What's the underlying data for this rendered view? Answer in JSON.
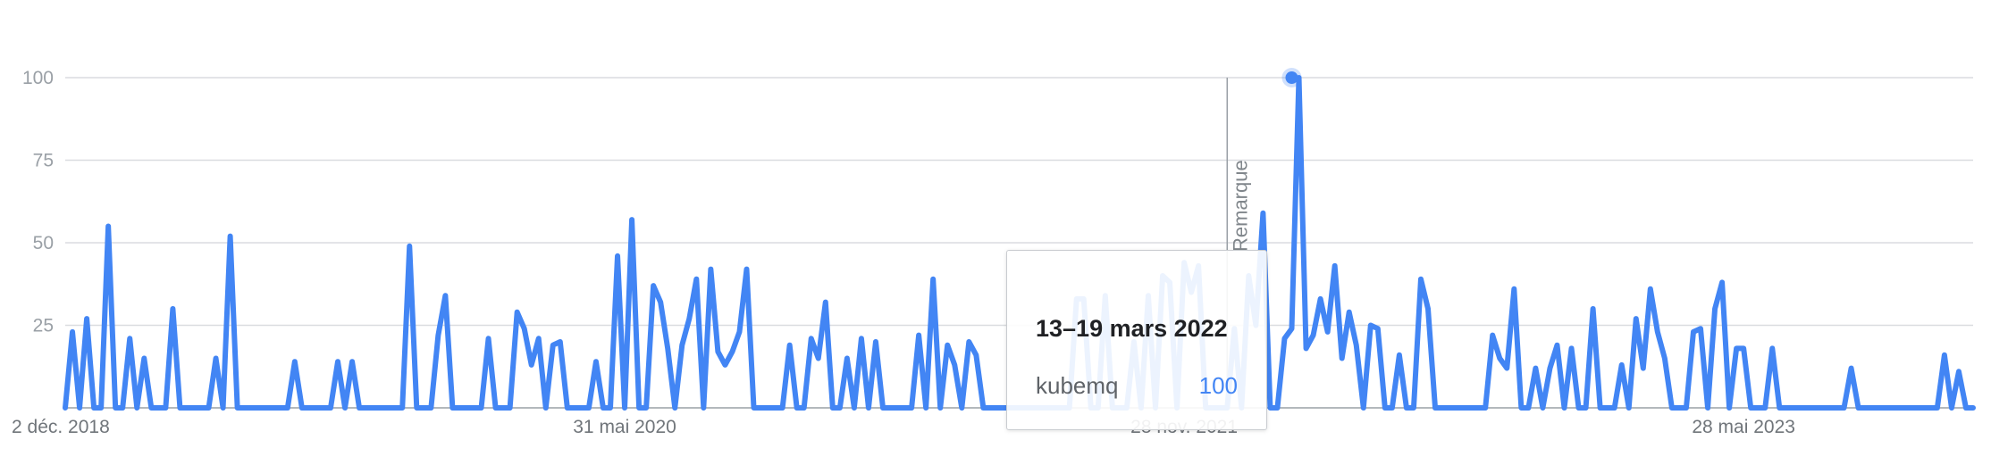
{
  "chart_data": {
    "type": "line",
    "title": "",
    "xlabel": "",
    "ylabel": "",
    "ylim": [
      0,
      100
    ],
    "yticks": [
      25,
      50,
      75,
      100
    ],
    "xtick_labels": [
      "2 déc. 2018",
      "31 mai 2020",
      "28 nov. 2021",
      "28 mai 2023"
    ],
    "grid": true,
    "legend": "none",
    "series": [
      {
        "name": "kubemq",
        "color": "#4285f4",
        "values": [
          0,
          23,
          0,
          27,
          0,
          0,
          55,
          0,
          0,
          21,
          0,
          15,
          0,
          0,
          0,
          30,
          0,
          0,
          0,
          0,
          0,
          15,
          0,
          52,
          0,
          0,
          0,
          0,
          0,
          0,
          0,
          0,
          14,
          0,
          0,
          0,
          0,
          0,
          14,
          0,
          14,
          0,
          0,
          0,
          0,
          0,
          0,
          0,
          49,
          0,
          0,
          0,
          22,
          34,
          0,
          0,
          0,
          0,
          0,
          21,
          0,
          0,
          0,
          29,
          24,
          13,
          21,
          0,
          19,
          20,
          0,
          0,
          0,
          0,
          14,
          0,
          0,
          46,
          0,
          57,
          0,
          0,
          37,
          32,
          18,
          0,
          19,
          27,
          39,
          0,
          42,
          17,
          13,
          17,
          23,
          42,
          0,
          0,
          0,
          0,
          0,
          19,
          0,
          0,
          21,
          15,
          32,
          0,
          0,
          15,
          0,
          21,
          0,
          20,
          0,
          0,
          0,
          0,
          0,
          22,
          0,
          39,
          0,
          19,
          13,
          0,
          20,
          16,
          0,
          0,
          0,
          0,
          0,
          0,
          0,
          0,
          0,
          0,
          0,
          0,
          0,
          33,
          33,
          0,
          0,
          34,
          0,
          0,
          0,
          20,
          0,
          34,
          0,
          40,
          38,
          0,
          44,
          35,
          43,
          0,
          0,
          0,
          0,
          24,
          0,
          40,
          25,
          59,
          0,
          0,
          21,
          24,
          100,
          18,
          22,
          33,
          23,
          43,
          15,
          29,
          19,
          0,
          25,
          24,
          0,
          0,
          16,
          0,
          0,
          39,
          30,
          0,
          0,
          0,
          0,
          0,
          0,
          0,
          0,
          22,
          15,
          12,
          36,
          0,
          0,
          12,
          0,
          12,
          19,
          0,
          18,
          0,
          0,
          30,
          0,
          0,
          0,
          13,
          0,
          27,
          12,
          36,
          23,
          15,
          0,
          0,
          0,
          23,
          24,
          0,
          30,
          38,
          0,
          18,
          18,
          0,
          0,
          0,
          18,
          0,
          0,
          0,
          0,
          0,
          0,
          0,
          0,
          0,
          0,
          12,
          0,
          0,
          0,
          0,
          0,
          0,
          0,
          0,
          0,
          0,
          0,
          0,
          16,
          0,
          11,
          0,
          0
        ]
      }
    ],
    "highlight": {
      "index": 171,
      "date": "13–19 mars 2022",
      "value": 100
    },
    "annotation": {
      "label": "Remarque",
      "index": 162
    }
  },
  "tooltip": {
    "date": "13–19 mars 2022",
    "term": "kubemq",
    "value": "100"
  }
}
